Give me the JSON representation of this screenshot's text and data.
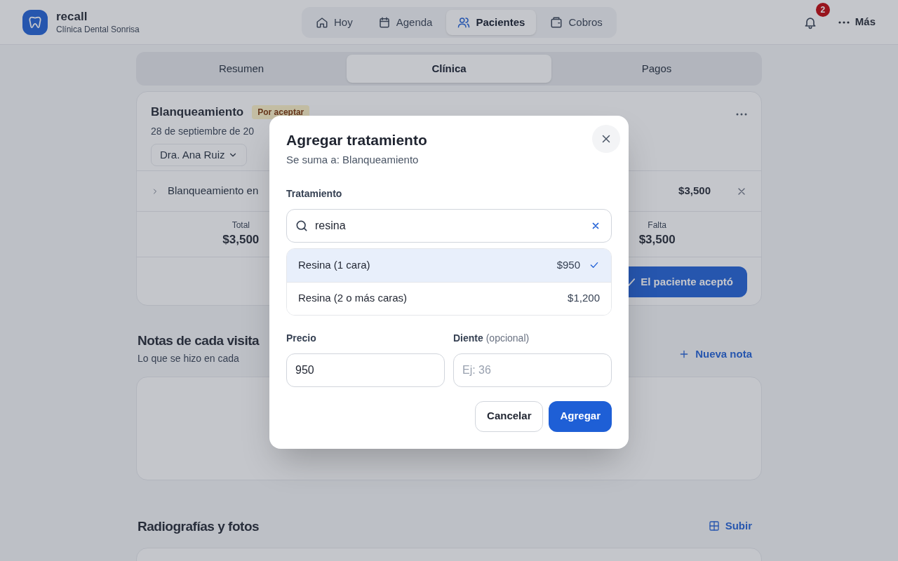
{
  "app": {
    "name": "recall",
    "clinic": "Clínica Dental Sonrisa"
  },
  "nav": [
    {
      "label": "Hoy",
      "selected": false
    },
    {
      "label": "Agenda",
      "selected": false
    },
    {
      "label": "Pacientes",
      "selected": true
    },
    {
      "label": "Cobros",
      "selected": false
    }
  ],
  "notifications": {
    "count": "2"
  },
  "more_menu": {
    "label": "Más"
  },
  "section_tabs": [
    {
      "label": "Resumen",
      "selected": false
    },
    {
      "label": "Clínica",
      "selected": true
    },
    {
      "label": "Pagos",
      "selected": false
    }
  ],
  "plan": {
    "title": "Blanqueamiento",
    "badge": "Por aceptar",
    "date": "28 de septiembre de 20",
    "doctor": "Dra. Ana Ruiz",
    "items": [
      {
        "name": "Blanqueamiento en",
        "price": "$3,500"
      }
    ],
    "totals": [
      {
        "label": "Total",
        "value": "$3,500"
      },
      {
        "label": "Falta",
        "value": "$3,500"
      }
    ],
    "accept_button": "El paciente aceptó"
  },
  "notes": {
    "title": "Notas de cada visita",
    "subtitle": "Lo que se hizo en cada",
    "action": "Nueva nota"
  },
  "media": {
    "title": "Radiografías y fotos",
    "action": "Subir"
  },
  "dialog": {
    "title": "Agregar tratamiento",
    "subtitle": "Se suma a: Blanqueamiento",
    "treatment_label": "Tratamiento",
    "search_value": "resina",
    "options": [
      {
        "name": "Resina (1 cara)",
        "price": "$950",
        "selected": true
      },
      {
        "name": "Resina (2 o más caras)",
        "price": "$1,200",
        "selected": false
      }
    ],
    "price_label": "Precio",
    "price_value": "950",
    "tooth_label": "Diente",
    "tooth_hint": "(opcional)",
    "tooth_placeholder": "Ej: 36",
    "cancel": "Cancelar",
    "submit": "Agregar"
  }
}
